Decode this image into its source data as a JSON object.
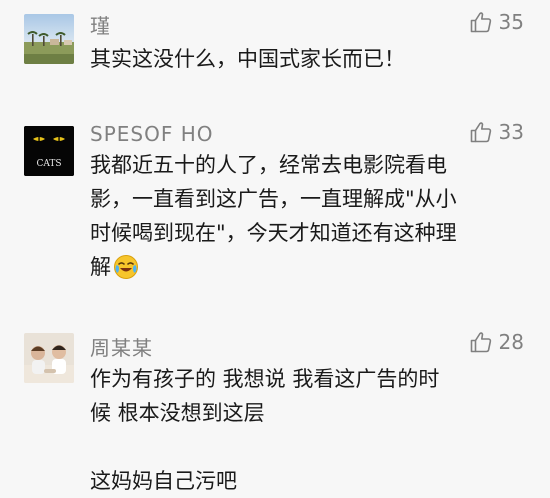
{
  "comments": [
    {
      "name": "瑾",
      "likes": "35",
      "lines": [
        "其实这没什么，中国式家长而已！"
      ]
    },
    {
      "name": "SPESOF HO",
      "likes": "33",
      "avatar_text": "CATS",
      "lines": [
        "我都近五十的人了，经常去电影院看电",
        "影，一直看到这广告，一直理解成\"从小",
        "时候喝到现在\"，今天才知道还有这种理",
        "解"
      ]
    },
    {
      "name": "周某某",
      "likes": "28",
      "lines": [
        "作为有孩子的 我想说 我看这广告的时",
        "候 根本没想到这层",
        "",
        "这妈妈自己污吧"
      ]
    }
  ],
  "icons": {
    "like": "thumbs-up-icon",
    "emoji": "laughing-crying-emoji"
  },
  "colors": {
    "background": "#f7f7f7",
    "muted": "#808080",
    "text": "#1a1a1a"
  }
}
